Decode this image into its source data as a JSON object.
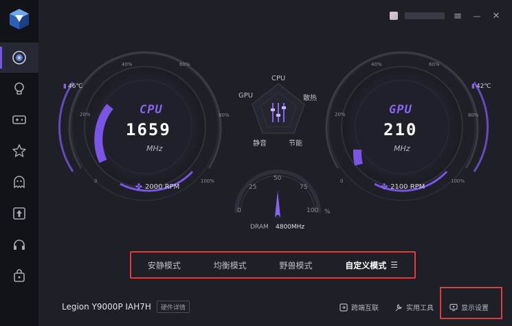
{
  "topbar": {
    "menu_icon": "≡",
    "minimize_icon": "—",
    "close_icon": "✕"
  },
  "cpu": {
    "title": "CPU",
    "value": "1659",
    "unit": "MHz",
    "rpm": "2000 RPM",
    "temp": "46℃",
    "ticks": {
      "p0": "0",
      "p20": "20%",
      "p40": "40%",
      "p60": "60%",
      "p80": "80%",
      "p100": "100%"
    },
    "color": "#8a63f0"
  },
  "gpu": {
    "title": "GPU",
    "value": "210",
    "unit": "MHz",
    "rpm": "2100 RPM",
    "temp": "42℃",
    "ticks": {
      "p0": "0",
      "p20": "20%",
      "p40": "40%",
      "p60": "60%",
      "p80": "80%",
      "p100": "100%"
    },
    "color": "#8a63f0"
  },
  "radar": {
    "labels": {
      "top": "CPU",
      "left": "GPU",
      "right": "散热",
      "bottom_left": "静音",
      "bottom_right": "节能"
    }
  },
  "dram": {
    "label": "DRAM",
    "value": "4800MHz",
    "scale": {
      "s0": "0",
      "s25": "25",
      "s50": "50",
      "s75": "75",
      "s100": "100",
      "unit": "%"
    }
  },
  "modes": [
    {
      "label": "安静模式",
      "active": false
    },
    {
      "label": "均衡模式",
      "active": false
    },
    {
      "label": "野兽模式",
      "active": false
    },
    {
      "label": "自定义模式",
      "active": true
    }
  ],
  "footer": {
    "device": "Legion Y9000P IAH7H",
    "hw_detail": "硬件详情",
    "cross_link": "跨端互联",
    "tools": "实用工具",
    "display": "显示设置"
  },
  "colors": {
    "accent": "#7a55e6",
    "highlight_border": "#e23b3b",
    "background": "#1e1f27",
    "sidebar": "#121318"
  }
}
